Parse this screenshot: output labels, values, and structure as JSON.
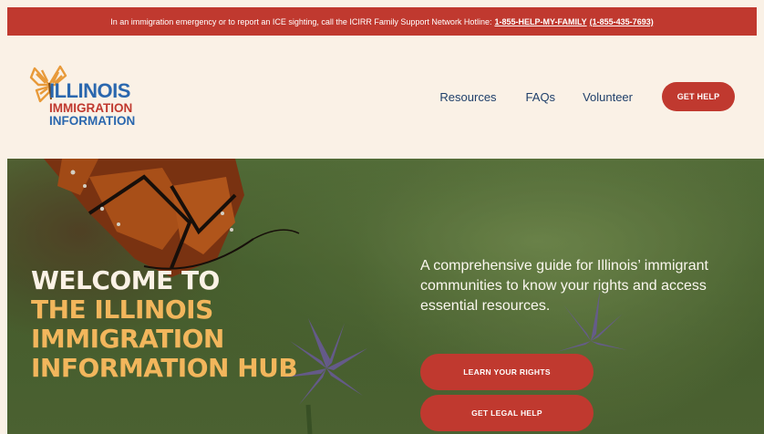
{
  "alert": {
    "text": "In an immigration emergency or to report an ICE sighting, call the ICIRR Family Support Network Hotline:",
    "hotline_word": "1-855-HELP-MY-FAMILY",
    "hotline_number": "(1-855-435-7693)"
  },
  "logo": {
    "line1": "ILLINOIS",
    "line2": "IMMIGRATION",
    "line3": "INFORMATION"
  },
  "nav": {
    "items": [
      "Resources",
      "FAQs",
      "Volunteer"
    ],
    "cta": "GET HELP"
  },
  "hero": {
    "title_line1": "WELCOME TO",
    "title_line2": "THE ILLINOIS",
    "title_line3": "IMMIGRATION",
    "title_line4": "INFORMATION HUB",
    "description": "A comprehensive guide for Illinois’ immigrant communities to know your rights and access essential resources.",
    "button1": "LEARN YOUR RIGHTS",
    "button2": "GET LEGAL HELP"
  },
  "colors": {
    "brand_red": "#c0392f",
    "brand_blue": "#2a67ae",
    "accent_orange": "#f2b65c",
    "cream": "#faf1e6"
  },
  "icons": {
    "logo_mark": "butterfly-icon"
  }
}
